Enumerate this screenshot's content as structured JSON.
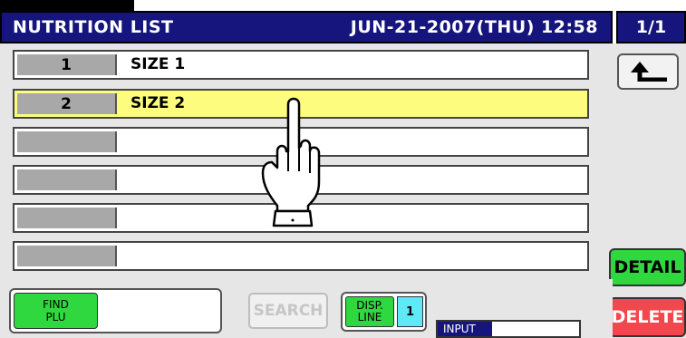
{
  "header": {
    "title": "NUTRITION LIST",
    "datetime": "JUN-21-2007(THU) 12:58",
    "page": "1/1"
  },
  "rows": [
    {
      "num": "1",
      "name": "SIZE 1",
      "selected": false
    },
    {
      "num": "2",
      "name": "SIZE 2",
      "selected": true
    },
    {
      "num": "",
      "name": "",
      "selected": false
    },
    {
      "num": "",
      "name": "",
      "selected": false
    },
    {
      "num": "",
      "name": "",
      "selected": false
    },
    {
      "num": "",
      "name": "",
      "selected": false
    }
  ],
  "side": {
    "back_icon": "return-arrow-icon",
    "detail_label": "DETAIL",
    "delete_label": "DELETE"
  },
  "bottom": {
    "find_plu_line1": "FIND",
    "find_plu_line2": "PLU",
    "find_plu_value": "",
    "search_label": "SEARCH",
    "disp_line1": "DISP.",
    "disp_line2": "LINE",
    "disp_value": "1",
    "input_label": "INPUT",
    "input_value": ""
  },
  "overlay": {
    "hand_icon": "pointing-hand-icon"
  },
  "colors": {
    "title_bg": "#16157e",
    "selected_row": "#fdfc7e",
    "button_green": "#2fd83e",
    "button_red": "#f0484c",
    "disp_cyan": "#5fe8f5"
  }
}
